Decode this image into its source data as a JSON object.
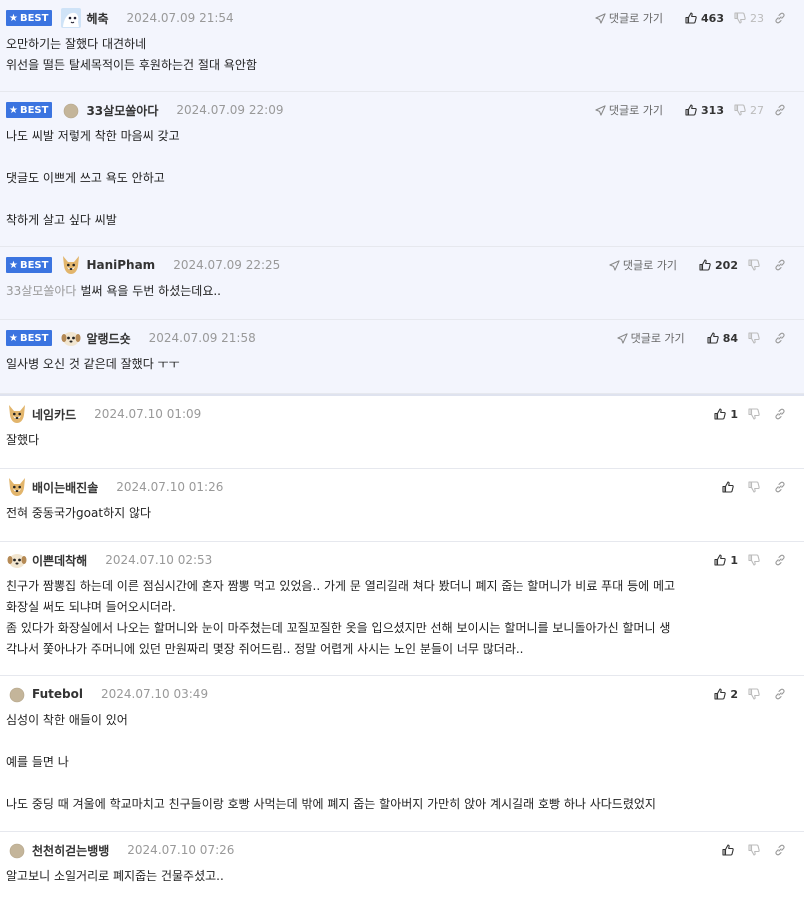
{
  "ui": {
    "best_label": "BEST",
    "goto_label": "댓글로 가기"
  },
  "comments": [
    {
      "best": true,
      "avatar": "sky-avatar",
      "nick": "헤축",
      "date": "2024.07.09 21:54",
      "goto": true,
      "up": "463",
      "down": "23",
      "mention": "",
      "text": "오만하기는 잘했다 대견하네\n위선을 떨든 탈세목적이든 후원하는건 절대 욕안함",
      "height": 92
    },
    {
      "best": true,
      "avatar": "dot-avatar",
      "nick": "33살모쏠아다",
      "date": "2024.07.09 22:09",
      "goto": true,
      "up": "313",
      "down": "27",
      "mention": "",
      "text": "나도 씨발 저렇게 착한 마음씨 갖고\n\n댓글도 이쁘게 쓰고 욕도 안하고\n\n착하게 살고 싶다 씨발",
      "height": 155
    },
    {
      "best": true,
      "avatar": "dog-avatar",
      "nick": "HaniPham",
      "date": "2024.07.09 22:25",
      "goto": true,
      "up": "202",
      "down": "",
      "mention": "33살모쏠아다",
      "text": "벌써 욕을 두번 하셨는데요..",
      "height": 73
    },
    {
      "best": true,
      "avatar": "puppy-avatar",
      "nick": "알랭드숏",
      "date": "2024.07.09 21:58",
      "goto": true,
      "up": "84",
      "down": "",
      "mention": "",
      "text": "일사병 오신 것 같은데 잘했다 ㅜㅜ",
      "height": 74
    },
    {
      "best": false,
      "avatar": "dog-avatar",
      "nick": "네임카드",
      "date": "2024.07.10 01:09",
      "goto": false,
      "up": "1",
      "down": "",
      "mention": "",
      "text": "잘했다",
      "height": 75
    },
    {
      "best": false,
      "avatar": "dog-avatar",
      "nick": "배이는배진솔",
      "date": "2024.07.10 01:26",
      "goto": false,
      "up": "",
      "down": "",
      "mention": "",
      "text": "전혀 중동국가goat하지 않다",
      "height": 73
    },
    {
      "best": false,
      "avatar": "puppy-avatar",
      "nick": "이쁜데착해",
      "date": "2024.07.10 02:53",
      "goto": false,
      "up": "1",
      "down": "",
      "mention": "",
      "text": "친구가 짬뽕집 하는데 이른 점심시간에 혼자 짬뽕 먹고 있었음.. 가게 문 열리길래 쳐다 봤더니 폐지 줍는 할머니가 비료 푸대 등에 메고\n화장실 써도 되냐며 들어오시더라.\n좀 있다가 화장실에서 나오는 할머니와 눈이 마주쳤는데 꼬질꼬질한 옷을 입으셨지만 선해 보이시는 할머니를 보니돌아가신 할머니 생\n각나서 쫓아나가 주머니에 있던 만원짜리 몇장 쥐어드림.. 정말 어렵게 사시는 노인 분들이 너무 많더라..",
      "height": 134
    },
    {
      "best": false,
      "avatar": "dot-avatar",
      "nick": "Futebol",
      "date": "2024.07.10 03:49",
      "goto": false,
      "up": "2",
      "down": "",
      "mention": "",
      "text": "심성이 착한 애들이 있어\n\n예를 들면 나\n\n나도 중딩 때 겨울에 학교마치고 친구들이랑 호빵 사먹는데 밖에 폐지 줍는 할아버지 가만히 앉아 계시길래 호빵 하나 사다드렸었지",
      "height": 156
    },
    {
      "best": false,
      "avatar": "dot-avatar",
      "nick": "천천히걷는뱅뱅",
      "date": "2024.07.10 07:26",
      "goto": false,
      "up": "",
      "down": "",
      "mention": "",
      "text": "알고보니 소일거리로 폐지줍는 건물주셨고..",
      "height": 72
    }
  ]
}
